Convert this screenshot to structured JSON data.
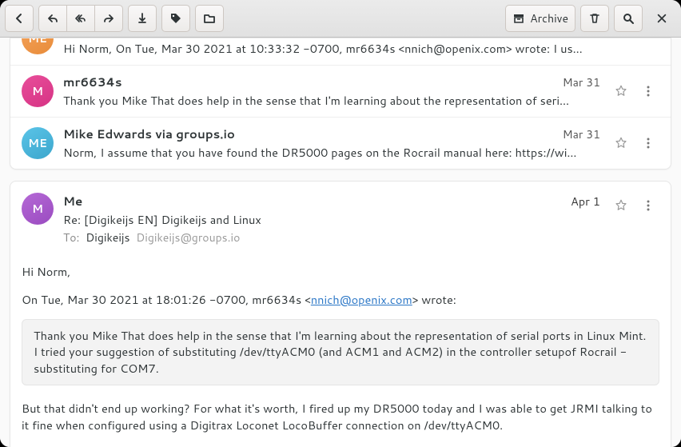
{
  "toolbar": {
    "archive_label": "Archive"
  },
  "thread": [
    {
      "avatar": "ME",
      "avclass": "av-orange",
      "from": "",
      "date": "",
      "preview": "Hi Norm, On Tue, Mar 30 2021 at 10:33:32 -0700, mr6634s <nnich@openix.com> wrote: I us…"
    },
    {
      "avatar": "M",
      "avclass": "av-pink",
      "from": "mr6634s",
      "date": "Mar 31",
      "preview": "Thank you Mike That does help in the sense that I'm learning about the representation of seri…"
    },
    {
      "avatar": "ME",
      "avclass": "av-blue",
      "from": "Mike Edwards via groups.io",
      "date": "Mar 31",
      "preview": "Norm, I assume that you have found the DR5000 pages on the Rocrail manual here: https://wi…"
    }
  ],
  "expanded": {
    "avatar": "M",
    "avclass": "av-purple",
    "from": "Me",
    "date": "Apr 1",
    "subject": "Re: [Digikeijs EN] Digikeijs and Linux",
    "to_label": "To:",
    "to_name": "Digikeijs",
    "to_addr": "Digikeijs@groups.io",
    "greeting": "Hi Norm,",
    "quote_intro_pre": "On Tue, Mar 30 2021 at 18:01:26 -0700, mr6634s <",
    "quote_intro_link": "nnich@openix.com",
    "quote_intro_post": "> wrote:",
    "quoted": "Thank you Mike     That does help in the sense that I'm learning about the representation of serial ports in Linux Mint.  I tried your suggestion of substituting /dev/ttyACM0 (and ACM1 and ACM2) in the controller setupof Rocrail - substituting for COM7.",
    "reply": "But that didn't end up working? For what it's worth, I fired up my DR5000 today and I was able to get JRMI talking to it fine when configured using a Digitrax Loconet LocoBuffer connection on /dev/ttyACM0."
  }
}
